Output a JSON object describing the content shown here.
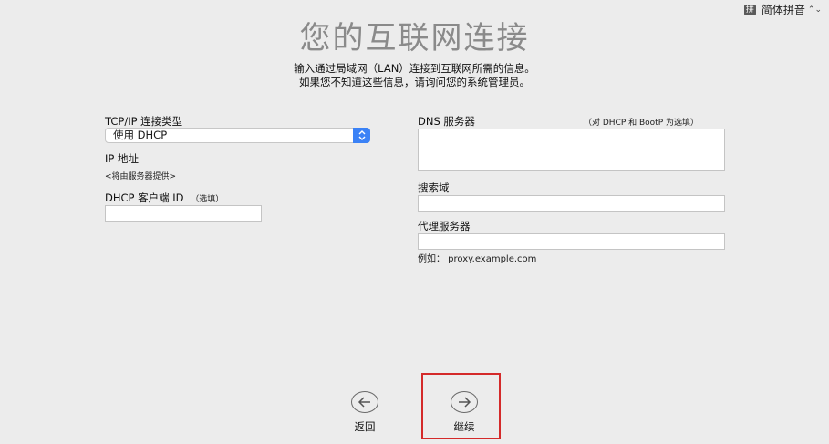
{
  "input_method": {
    "badge": "拼",
    "label": "简体拼音"
  },
  "header": {
    "title": "您的互联网连接",
    "subtitle_line1": "输入通过局域网（LAN）连接到互联网所需的信息。",
    "subtitle_line2": "如果您不知道这些信息，请询问您的系统管理员。"
  },
  "left": {
    "conn_type_label": "TCP/IP 连接类型",
    "conn_type_value": "使用 DHCP",
    "ip_label": "IP 地址",
    "ip_value": "<将由服务器提供>",
    "dhcp_label": "DHCP 客户端 ID",
    "dhcp_optional": "（选填）",
    "dhcp_value": ""
  },
  "right": {
    "dns_label": "DNS 服务器",
    "dns_hint": "（对 DHCP 和 BootP 为选填）",
    "dns_value": "",
    "search_label": "搜索域",
    "search_value": "",
    "proxy_label": "代理服务器",
    "proxy_value": "",
    "proxy_example": "例如： proxy.example.com"
  },
  "nav": {
    "back_label": "返回",
    "continue_label": "继续"
  },
  "colors": {
    "accent": "#3b82f6",
    "highlight": "#d42a2a",
    "title": "#8a8a8a"
  }
}
